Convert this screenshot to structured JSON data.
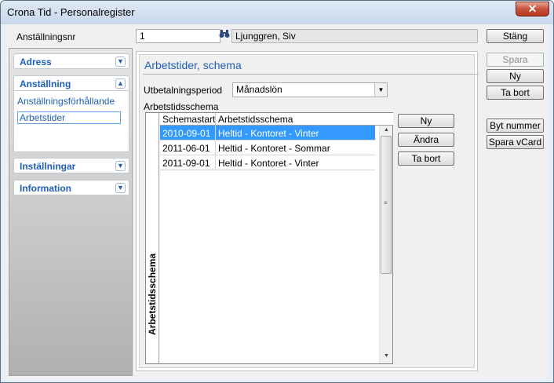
{
  "window": {
    "title": "Crona Tid - Personalregister",
    "close_glyph": "✕"
  },
  "topbar": {
    "employee_label": "Anställningsnr",
    "employee_number": "1",
    "employee_name": "Ljunggren, Siv",
    "close_label": "Stäng"
  },
  "sidebar": {
    "sections": [
      {
        "label": "Adress",
        "expanded": false
      },
      {
        "label": "Anställning",
        "expanded": true
      },
      {
        "label": "Inställningar",
        "expanded": false
      },
      {
        "label": "Information",
        "expanded": false
      }
    ],
    "sub_items": [
      "Anställningsförhållande",
      "Arbetstider"
    ],
    "selected_sub": "Arbetstider"
  },
  "main": {
    "section_title": "Arbetstider, schema",
    "payout_label": "Utbetalningsperiod",
    "payout_value": "Månadslön",
    "grid_label": "Arbetstidsschema",
    "grid_tab_label": "Arbetstidsschema",
    "columns": [
      "Schemastart",
      "Arbetstidsschema"
    ],
    "rows": [
      {
        "start": "2010-09-01",
        "schedule": "Heltid - Kontoret - Vinter",
        "selected": true
      },
      {
        "start": "2011-06-01",
        "schedule": "Heltid - Kontoret - Sommar",
        "selected": false
      },
      {
        "start": "2011-09-01",
        "schedule": "Heltid - Kontoret - Vinter",
        "selected": false
      }
    ],
    "grid_buttons": [
      "Ny",
      "Ändra",
      "Ta bort"
    ]
  },
  "right_buttons": {
    "save": "Spara",
    "new": "Ny",
    "delete": "Ta bort",
    "change_number": "Byt nummer",
    "save_vcard": "Spara vCard"
  },
  "colors": {
    "accent": "#1e5fb5",
    "selection": "#3399ff",
    "close": "#c7513b"
  }
}
